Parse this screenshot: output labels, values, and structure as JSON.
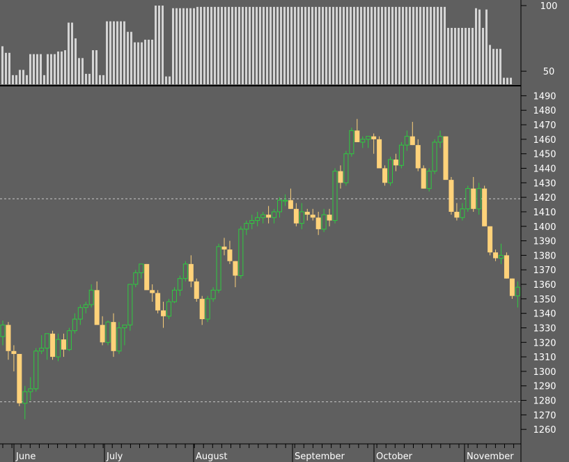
{
  "colors": {
    "background": "#5f5f5f",
    "up_candle": "#2ecc40",
    "down_candle": "#ffd27a",
    "oscillator_bar": "#d4d4d4",
    "axis_text": "#ffffff",
    "divider": "#000000",
    "reference_line": "#c8c8c8"
  },
  "chart_data": [
    {
      "type": "bar",
      "panel": "oscillator",
      "ylim": [
        40,
        100
      ],
      "yticks": [
        50,
        100
      ],
      "ytick_labels": [
        "50",
        "100"
      ],
      "values": [
        69,
        64,
        64,
        47,
        47,
        51,
        51,
        47,
        63,
        63,
        63,
        63,
        47,
        63,
        63,
        63,
        65,
        65,
        66,
        87,
        87,
        75,
        60,
        60,
        48,
        48,
        66,
        66,
        47,
        47,
        88,
        88,
        88,
        88,
        88,
        88,
        80,
        80,
        72,
        72,
        72,
        74,
        74,
        74,
        100,
        100,
        100,
        46,
        46,
        98,
        98,
        98,
        98,
        98,
        98,
        98,
        99,
        99,
        99,
        99,
        99,
        99,
        99,
        99,
        99,
        99,
        99,
        99,
        99,
        99,
        99,
        99,
        99,
        99,
        99,
        99,
        99,
        99,
        99,
        99,
        99,
        99,
        99,
        99,
        99,
        99,
        99,
        99,
        99,
        99,
        99,
        99,
        99,
        99,
        99,
        99,
        99,
        99,
        99,
        99,
        99,
        99,
        99,
        99,
        99,
        99,
        99,
        99,
        99,
        99,
        99,
        99,
        99,
        99,
        99,
        99,
        99,
        99,
        99,
        99,
        99,
        99,
        99,
        99,
        99,
        99,
        99,
        99,
        83,
        83,
        83,
        83,
        83,
        83,
        83,
        83,
        98,
        97,
        83,
        97,
        70,
        67,
        67,
        67,
        45,
        45,
        45
      ]
    },
    {
      "type": "candlestick",
      "panel": "price",
      "ylim": [
        1250,
        1495
      ],
      "yticks": [
        1260,
        1270,
        1280,
        1290,
        1300,
        1310,
        1320,
        1330,
        1340,
        1350,
        1360,
        1370,
        1380,
        1390,
        1400,
        1410,
        1420,
        1430,
        1440,
        1450,
        1460,
        1470,
        1480,
        1490
      ],
      "ytick_labels": [
        "1260",
        "1270",
        "1280",
        "1290",
        "1300",
        "1310",
        "1320",
        "1330",
        "1340",
        "1350",
        "1360",
        "1370",
        "1380",
        "1390",
        "1400",
        "1410",
        "1420",
        "1430",
        "1440",
        "1450",
        "1460",
        "1470",
        "1480",
        "1490"
      ],
      "x_labels": [
        "June",
        "July",
        "August",
        "September",
        "October",
        "November"
      ],
      "reference_levels": [
        1419,
        1279
      ],
      "candles": [
        [
          1324,
          1335,
          1318,
          1332
        ],
        [
          1332,
          1334,
          1308,
          1314
        ],
        [
          1314,
          1318,
          1300,
          1312
        ],
        [
          1312,
          1312,
          1276,
          1278
        ],
        [
          1278,
          1290,
          1267,
          1286
        ],
        [
          1286,
          1296,
          1280,
          1288
        ],
        [
          1288,
          1316,
          1286,
          1314
        ],
        [
          1314,
          1325,
          1312,
          1316
        ],
        [
          1316,
          1324,
          1308,
          1326
        ],
        [
          1326,
          1328,
          1308,
          1310
        ],
        [
          1310,
          1326,
          1307,
          1322
        ],
        [
          1322,
          1326,
          1310,
          1315
        ],
        [
          1315,
          1330,
          1314,
          1328
        ],
        [
          1328,
          1340,
          1326,
          1336
        ],
        [
          1336,
          1346,
          1332,
          1344
        ],
        [
          1344,
          1348,
          1340,
          1346
        ],
        [
          1346,
          1360,
          1344,
          1356
        ],
        [
          1356,
          1362,
          1333,
          1332
        ],
        [
          1332,
          1338,
          1318,
          1320
        ],
        [
          1320,
          1335,
          1318,
          1334
        ],
        [
          1334,
          1340,
          1310,
          1314
        ],
        [
          1314,
          1334,
          1312,
          1330
        ],
        [
          1330,
          1332,
          1318,
          1332
        ],
        [
          1332,
          1350,
          1328,
          1360
        ],
        [
          1360,
          1370,
          1358,
          1368
        ],
        [
          1368,
          1374,
          1364,
          1374
        ],
        [
          1374,
          1374,
          1358,
          1356
        ],
        [
          1356,
          1360,
          1348,
          1354
        ],
        [
          1354,
          1356,
          1340,
          1342
        ],
        [
          1342,
          1348,
          1330,
          1338
        ],
        [
          1338,
          1350,
          1336,
          1348
        ],
        [
          1348,
          1358,
          1347,
          1356
        ],
        [
          1356,
          1366,
          1352,
          1364
        ],
        [
          1364,
          1376,
          1362,
          1374
        ],
        [
          1374,
          1380,
          1358,
          1362
        ],
        [
          1362,
          1364,
          1348,
          1350
        ],
        [
          1350,
          1352,
          1332,
          1336
        ],
        [
          1336,
          1352,
          1334,
          1350
        ],
        [
          1350,
          1358,
          1348,
          1356
        ],
        [
          1356,
          1388,
          1354,
          1386
        ],
        [
          1386,
          1392,
          1380,
          1384
        ],
        [
          1384,
          1390,
          1374,
          1376
        ],
        [
          1376,
          1376,
          1358,
          1366
        ],
        [
          1366,
          1400,
          1364,
          1398
        ],
        [
          1398,
          1404,
          1394,
          1402
        ],
        [
          1402,
          1408,
          1398,
          1404
        ],
        [
          1404,
          1410,
          1400,
          1406
        ],
        [
          1406,
          1410,
          1402,
          1408
        ],
        [
          1408,
          1414,
          1402,
          1406
        ],
        [
          1406,
          1412,
          1402,
          1410
        ],
        [
          1410,
          1420,
          1406,
          1418
        ],
        [
          1418,
          1422,
          1414,
          1418
        ],
        [
          1418,
          1426,
          1412,
          1412
        ],
        [
          1412,
          1416,
          1400,
          1402
        ],
        [
          1402,
          1416,
          1398,
          1410
        ],
        [
          1410,
          1412,
          1404,
          1408
        ],
        [
          1408,
          1412,
          1404,
          1406
        ],
        [
          1406,
          1410,
          1394,
          1398
        ],
        [
          1398,
          1412,
          1396,
          1408
        ],
        [
          1408,
          1412,
          1400,
          1404
        ],
        [
          1404,
          1440,
          1402,
          1438
        ],
        [
          1438,
          1442,
          1426,
          1430
        ],
        [
          1430,
          1452,
          1428,
          1450
        ],
        [
          1450,
          1468,
          1448,
          1466
        ],
        [
          1466,
          1474,
          1458,
          1458
        ],
        [
          1458,
          1462,
          1454,
          1460
        ],
        [
          1460,
          1462,
          1454,
          1462
        ],
        [
          1462,
          1464,
          1450,
          1460
        ],
        [
          1460,
          1462,
          1444,
          1440
        ],
        [
          1440,
          1442,
          1428,
          1430
        ],
        [
          1430,
          1448,
          1428,
          1446
        ],
        [
          1446,
          1450,
          1438,
          1442
        ],
        [
          1442,
          1458,
          1440,
          1456
        ],
        [
          1456,
          1466,
          1452,
          1462
        ],
        [
          1462,
          1472,
          1456,
          1456
        ],
        [
          1456,
          1460,
          1438,
          1440
        ],
        [
          1440,
          1442,
          1426,
          1426
        ],
        [
          1426,
          1440,
          1424,
          1438
        ],
        [
          1438,
          1460,
          1436,
          1458
        ],
        [
          1458,
          1466,
          1454,
          1462
        ],
        [
          1462,
          1462,
          1440,
          1432
        ],
        [
          1432,
          1434,
          1408,
          1410
        ],
        [
          1410,
          1416,
          1404,
          1406
        ],
        [
          1406,
          1416,
          1404,
          1412
        ],
        [
          1412,
          1428,
          1410,
          1426
        ],
        [
          1426,
          1434,
          1410,
          1412
        ],
        [
          1412,
          1430,
          1408,
          1426
        ],
        [
          1426,
          1428,
          1400,
          1400
        ],
        [
          1400,
          1400,
          1380,
          1382
        ],
        [
          1382,
          1384,
          1376,
          1378
        ],
        [
          1378,
          1388,
          1374,
          1380
        ],
        [
          1380,
          1382,
          1364,
          1364
        ],
        [
          1364,
          1364,
          1350,
          1352
        ],
        [
          1352,
          1362,
          1344,
          1358
        ]
      ]
    }
  ]
}
